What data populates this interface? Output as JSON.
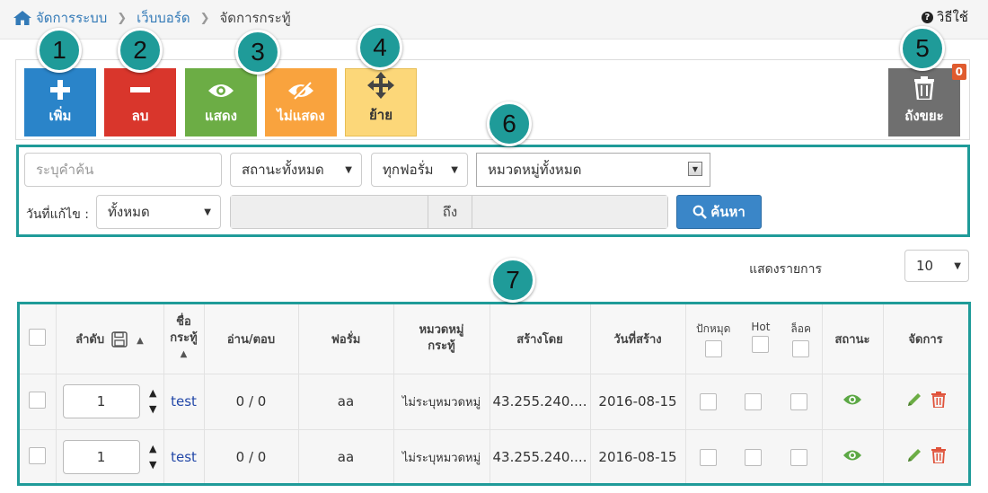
{
  "breadcrumb": {
    "items": [
      "จัดการระบบ",
      "เว็บบอร์ด"
    ],
    "current": "จัดการกระทู้"
  },
  "help": {
    "label": "วิธีใช้"
  },
  "toolbar": {
    "add_label": "เพิ่ม",
    "delete_label": "ลบ",
    "show_label": "แสดง",
    "hide_label": "ไม่แสดง",
    "move_label": "ย้าย",
    "trash_label": "ถังขยะ",
    "trash_count": "0"
  },
  "callouts": [
    "1",
    "2",
    "3",
    "4",
    "5",
    "6",
    "7"
  ],
  "filter": {
    "keyword_placeholder": "ระบุคำค้น",
    "status_select": "สถานะทั้งหมด",
    "forum_select": "ทุกฟอรั่ม",
    "category_select": "หมวดหมู่ทั้งหมด",
    "date_label": "วันที่แก้ไข :",
    "date_select": "ทั้งหมด",
    "range_to": "ถึง",
    "search_label": "ค้นหา"
  },
  "paging": {
    "label": "แสดงรายการ",
    "value": "10"
  },
  "table": {
    "headers": {
      "order": "ลำดับ",
      "name_l1": "ชื่อ",
      "name_l2": "กระทู้",
      "reads": "อ่าน/ตอบ",
      "forum": "ฟอรั่ม",
      "category_l1": "หมวดหมู่",
      "category_l2": "กระทู้",
      "created_by": "สร้างโดย",
      "created_date": "วันที่สร้าง",
      "pin": "ปักหมุด",
      "hot": "Hot",
      "lock": "ล็อค",
      "status": "สถานะ",
      "manage": "จัดการ"
    },
    "rows": [
      {
        "order": "1",
        "name": "test",
        "reads": "0 / 0",
        "forum": "aa",
        "category": "ไม่ระบุหมวดหมู่",
        "created_by": "43.255.240....",
        "created_date": "2016-08-15"
      },
      {
        "order": "1",
        "name": "test",
        "reads": "0 / 0",
        "forum": "aa",
        "category": "ไม่ระบุหมวดหมู่",
        "created_by": "43.255.240....",
        "created_date": "2016-08-15"
      }
    ]
  },
  "colors": {
    "accent": "#1f9b99",
    "add": "#2a84c9",
    "delete": "#d9362c",
    "show": "#6cad45",
    "hide": "#f9a33e",
    "move": "#fcd779",
    "trash": "#6f6f6f"
  }
}
